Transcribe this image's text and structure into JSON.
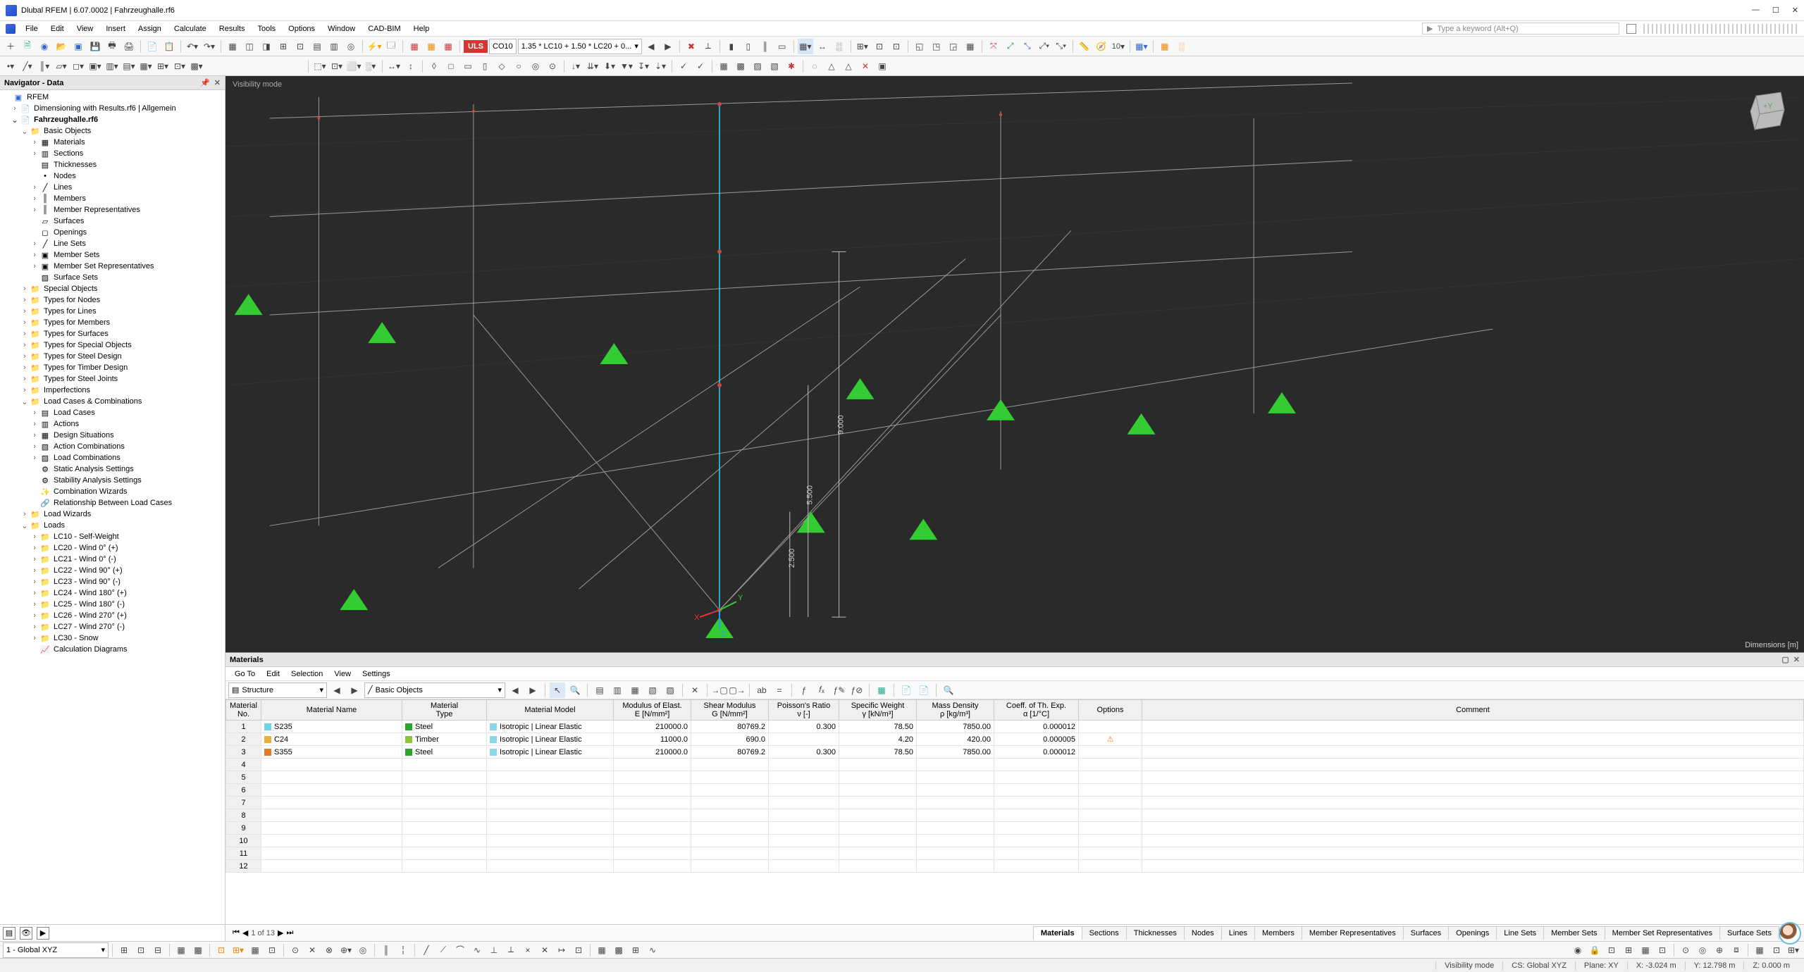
{
  "app_title": "Dlubal RFEM | 6.07.0002 | Fahrzeughalle.rf6",
  "menu": [
    "File",
    "Edit",
    "View",
    "Insert",
    "Assign",
    "Calculate",
    "Results",
    "Tools",
    "Options",
    "Window",
    "CAD-BIM",
    "Help"
  ],
  "search_placeholder": "Type a keyword (Alt+Q)",
  "combo": {
    "badge": "ULS",
    "case": "CO10",
    "desc": "1.35 * LC10 + 1.50 * LC20 + 0..."
  },
  "navigator": {
    "title": "Navigator - Data",
    "root": "RFEM",
    "model1": "Dimensioning with Results.rf6 | Allgemein",
    "model2": "Fahrzeughalle.rf6",
    "basic_objects": "Basic Objects",
    "basic_items": [
      "Materials",
      "Sections",
      "Thicknesses",
      "Nodes",
      "Lines",
      "Members",
      "Member Representatives",
      "Surfaces",
      "Openings",
      "Line Sets",
      "Member Sets",
      "Member Set Representatives",
      "Surface Sets"
    ],
    "groups": [
      "Special Objects",
      "Types for Nodes",
      "Types for Lines",
      "Types for Members",
      "Types for Surfaces",
      "Types for Special Objects",
      "Types for Steel Design",
      "Types for Timber Design",
      "Types for Steel Joints",
      "Imperfections"
    ],
    "lcc": "Load Cases & Combinations",
    "lcc_items": [
      "Load Cases",
      "Actions",
      "Design Situations",
      "Action Combinations",
      "Load Combinations",
      "Static Analysis Settings",
      "Stability Analysis Settings",
      "Combination Wizards",
      "Relationship Between Load Cases"
    ],
    "lw": "Load Wizards",
    "loads": "Loads",
    "load_items": [
      "LC10 - Self-Weight",
      "LC20 - Wind 0° (+)",
      "LC21 - Wind 0° (-)",
      "LC22 - Wind 90° (+)",
      "LC23 - Wind 90° (-)",
      "LC24 - Wind 180° (+)",
      "LC25 - Wind 180° (-)",
      "LC26 - Wind 270° (+)",
      "LC27 - Wind 270° (-)",
      "LC30 - Snow"
    ],
    "calc": "Calculation Diagrams"
  },
  "viewport": {
    "mode": "Visibility mode",
    "dims": "Dimensions [m]",
    "d1": "9.000",
    "d2": "5.500",
    "d3": "2.500"
  },
  "panel": {
    "title": "Materials",
    "menu": [
      "Go To",
      "Edit",
      "Selection",
      "View",
      "Settings"
    ],
    "tool_drop1": "Structure",
    "tool_drop2": "Basic Objects",
    "headers": {
      "no": "Material\nNo.",
      "name": "Material Name",
      "type": "Material\nType",
      "model": "Material Model",
      "E": "Modulus of Elast.\nE [N/mm²]",
      "G": "Shear Modulus\nG [N/mm²]",
      "nu": "Poisson's Ratio\nν [-]",
      "sw": "Specific Weight\nγ [kN/m³]",
      "md": "Mass Density\nρ [kg/m³]",
      "cte": "Coeff. of Th. Exp.\nα [1/°C]",
      "opt": "Options",
      "cmt": "Comment"
    },
    "rows": [
      {
        "no": 1,
        "name": "S235",
        "sw": "#6dd6e8",
        "type": "Steel",
        "tsw": "#2aa52a",
        "model": "Isotropic | Linear Elastic",
        "msw": "#8bd6e8",
        "E": "210000.0",
        "G": "80769.2",
        "nu": "0.300",
        "gamma": "78.50",
        "rho": "7850.00",
        "alpha": "0.000012",
        "opt": ""
      },
      {
        "no": 2,
        "name": "C24",
        "sw": "#e4b23a",
        "type": "Timber",
        "tsw": "#8ac43a",
        "model": "Isotropic | Linear Elastic",
        "msw": "#8bd6e8",
        "E": "11000.0",
        "G": "690.0",
        "nu": "",
        "gamma": "4.20",
        "rho": "420.00",
        "alpha": "0.000005",
        "opt": "⚠"
      },
      {
        "no": 3,
        "name": "S355",
        "sw": "#e27b2a",
        "type": "Steel",
        "tsw": "#2aa52a",
        "model": "Isotropic | Linear Elastic",
        "msw": "#8bd6e8",
        "E": "210000.0",
        "G": "80769.2",
        "nu": "0.300",
        "gamma": "78.50",
        "rho": "7850.00",
        "alpha": "0.000012",
        "opt": ""
      }
    ],
    "page": "1 of 13",
    "tabs": [
      "Materials",
      "Sections",
      "Thicknesses",
      "Nodes",
      "Lines",
      "Members",
      "Member Representatives",
      "Surfaces",
      "Openings",
      "Line Sets",
      "Member Sets",
      "Member Set Representatives",
      "Surface Sets"
    ]
  },
  "bottom_wp": "1 - Global XYZ",
  "status": {
    "vis": "Visibility mode",
    "cs": "CS: Global XYZ",
    "plane": "Plane: XY",
    "x": "X: -3.024 m",
    "y": "Y: 12.798 m",
    "z": "Z: 0.000 m"
  }
}
